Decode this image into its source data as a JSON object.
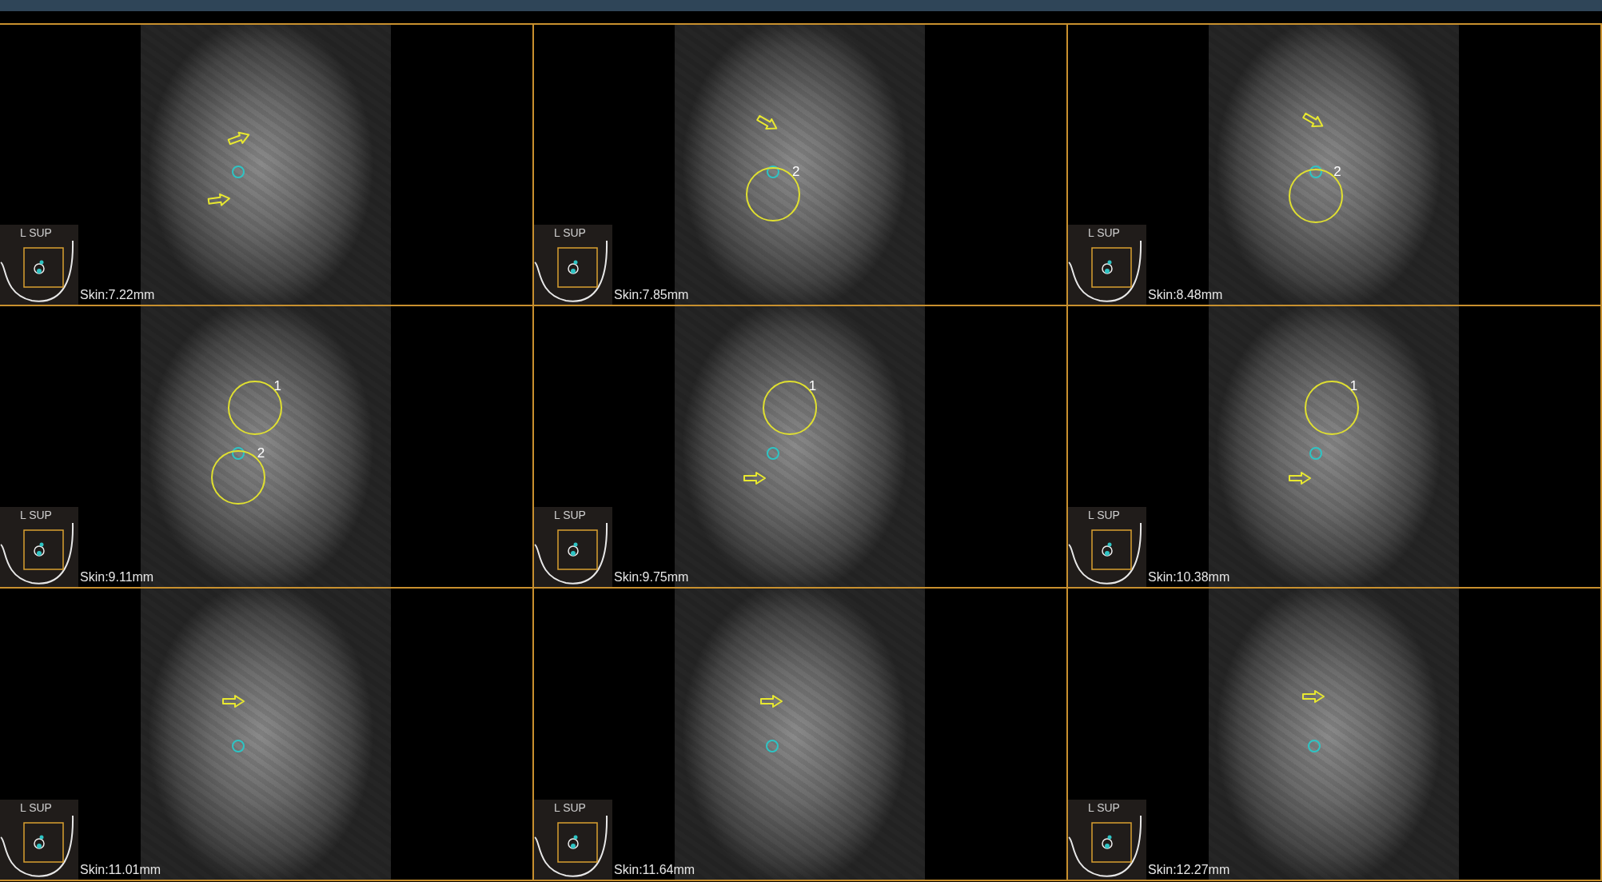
{
  "rows": [
    {
      "panels": [
        {
          "orientation": "L SUP",
          "skin": "Skin:7.22mm",
          "annotations": [
            {
              "kind": "arrow"
            },
            {
              "kind": "target"
            },
            {
              "kind": "arrow"
            }
          ]
        },
        {
          "orientation": "L SUP",
          "skin": "Skin:7.85mm",
          "annotations": [
            {
              "kind": "arrow"
            },
            {
              "kind": "target"
            },
            {
              "kind": "circle",
              "label": "2"
            }
          ]
        },
        {
          "orientation": "L SUP",
          "skin": "Skin:8.48mm",
          "annotations": [
            {
              "kind": "arrow"
            },
            {
              "kind": "target"
            },
            {
              "kind": "circle",
              "label": "2"
            }
          ]
        }
      ]
    },
    {
      "panels": [
        {
          "orientation": "L SUP",
          "skin": "Skin:9.11mm",
          "annotations": [
            {
              "kind": "circle",
              "label": "1"
            },
            {
              "kind": "target"
            },
            {
              "kind": "circle",
              "label": "2"
            }
          ]
        },
        {
          "orientation": "L SUP",
          "skin": "Skin:9.75mm",
          "annotations": [
            {
              "kind": "circle",
              "label": "1"
            },
            {
              "kind": "target"
            },
            {
              "kind": "arrow"
            }
          ]
        },
        {
          "orientation": "L SUP",
          "skin": "Skin:10.38mm",
          "annotations": [
            {
              "kind": "circle",
              "label": "1"
            },
            {
              "kind": "target"
            },
            {
              "kind": "arrow"
            }
          ]
        }
      ]
    },
    {
      "panels": [
        {
          "orientation": "L SUP",
          "skin": "Skin:11.01mm",
          "annotations": [
            {
              "kind": "arrow"
            },
            {
              "kind": "target"
            }
          ]
        },
        {
          "orientation": "L SUP",
          "skin": "Skin:11.64mm",
          "annotations": [
            {
              "kind": "arrow"
            },
            {
              "kind": "target"
            }
          ]
        },
        {
          "orientation": "L SUP",
          "skin": "Skin:12.27mm",
          "annotations": [
            {
              "kind": "arrow"
            },
            {
              "kind": "target"
            }
          ]
        }
      ]
    }
  ]
}
